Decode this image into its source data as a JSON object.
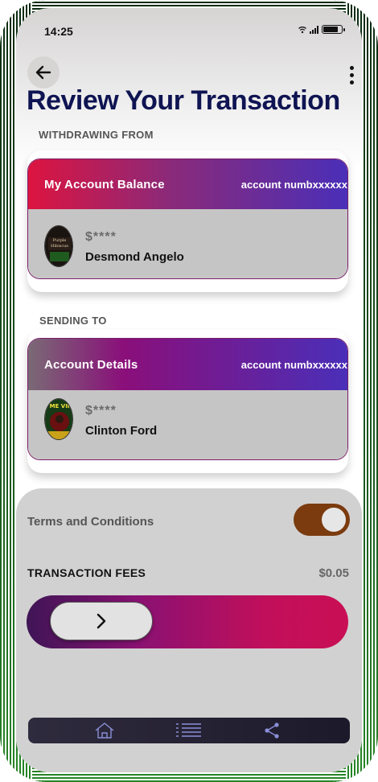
{
  "status_bar": {
    "time": "14:25",
    "battery_level": 0.8
  },
  "header": {
    "back_icon": "arrow-left-icon",
    "menu_icon": "more-vertical-icon",
    "title": "Review Your Transaction"
  },
  "withdraw": {
    "section_label": "WITHDRAWING FROM",
    "card_title": "My Account Balance",
    "account_number": "account numbxxxxxx",
    "amount": "$****",
    "name": "Desmond Angelo",
    "avatar_text": "Purple Hibiscus",
    "gradient": [
      "#dc1440",
      "#8a2a7a",
      "#4a2fb8"
    ]
  },
  "send": {
    "section_label": "SENDING TO",
    "card_title": "Account Details",
    "account_number": "account numbxxxxxx",
    "amount": "$****",
    "name": "Clinton Ford",
    "avatar_text": "ME VII",
    "gradient": [
      "#7a6a75",
      "#8a0f7a",
      "#4a2fb8"
    ]
  },
  "terms": {
    "label": "Terms and Conditions",
    "enabled": true,
    "toggle_color": "#7b3b0e"
  },
  "fees": {
    "label": "TRANSACTION FEES",
    "value": "$0.05"
  },
  "slider": {
    "icon": "chevron-right-icon"
  },
  "nav": {
    "items": [
      "home-icon",
      "list-icon",
      "share-icon"
    ]
  }
}
